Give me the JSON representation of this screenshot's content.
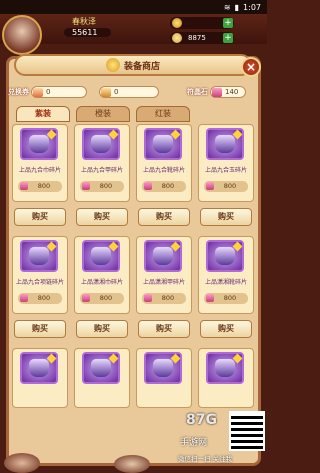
{
  "status": {
    "time": "1:07"
  },
  "player": {
    "name": "春秋泽",
    "power": "55611"
  },
  "currencies": [
    {
      "value": "",
      "icon": "gold-coin-icon"
    },
    {
      "value": "8875",
      "icon": "ingot-icon"
    }
  ],
  "title": "装备商店",
  "stats": {
    "exchange_label": "兑换券",
    "exchange_value": "0",
    "fragment_label": "",
    "fragment_value": "0",
    "gem_label": "符晶石",
    "gem_value": "140"
  },
  "tabs": [
    {
      "label": "紫装"
    },
    {
      "label": "橙装"
    },
    {
      "label": "红装"
    }
  ],
  "items": [
    {
      "name": "上品九合巾碎片",
      "price": "800",
      "buy": "购买"
    },
    {
      "name": "上品九合甲碎片",
      "price": "800",
      "buy": "购买"
    },
    {
      "name": "上品九合靴碎片",
      "price": "800",
      "buy": "购买"
    },
    {
      "name": "上品九合玉碎片",
      "price": "800",
      "buy": "购买"
    },
    {
      "name": "上品九合项链碎片",
      "price": "800",
      "buy": "购买"
    },
    {
      "name": "上品潇湘巾碎片",
      "price": "800",
      "buy": "购买"
    },
    {
      "name": "上品潇湘甲碎片",
      "price": "800",
      "buy": "购买"
    },
    {
      "name": "上品潇湘靴碎片",
      "price": "800",
      "buy": "购买"
    },
    {
      "name": "",
      "price": "",
      "buy": ""
    },
    {
      "name": "",
      "price": "",
      "buy": ""
    },
    {
      "name": "",
      "price": "",
      "buy": ""
    },
    {
      "name": "",
      "price": "",
      "buy": ""
    }
  ],
  "watermark": {
    "logo": "87G",
    "brand": "手游网",
    "sub": "微信扫一扫 关注我"
  }
}
